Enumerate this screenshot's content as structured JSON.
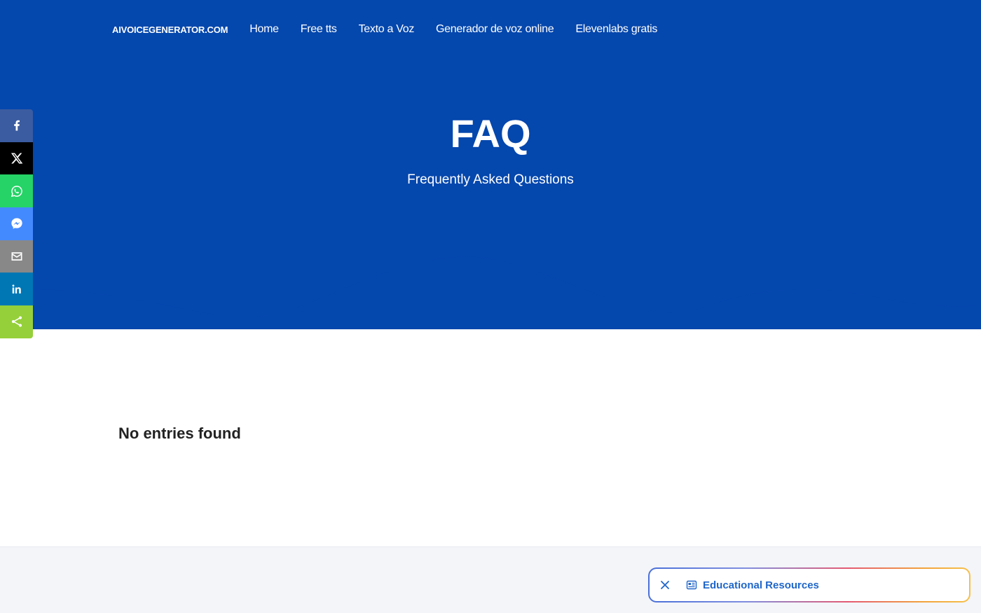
{
  "nav": {
    "brand": "AIVOICEGENERATOR.COM",
    "links": [
      "Home",
      "Free tts",
      "Texto a Voz",
      "Generador de voz online",
      "Elevenlabs gratis"
    ]
  },
  "hero": {
    "title": "FAQ",
    "subtitle": "Frequently Asked Questions",
    "background_color": "#0447ad"
  },
  "share": {
    "buttons": [
      {
        "icon": "facebook-icon",
        "color": "#3b5ca0"
      },
      {
        "icon": "x-icon",
        "color": "#000000"
      },
      {
        "icon": "whatsapp-icon",
        "color": "#25d366"
      },
      {
        "icon": "messenger-icon",
        "color": "#448aff"
      },
      {
        "icon": "email-icon",
        "color": "#888888"
      },
      {
        "icon": "linkedin-icon",
        "color": "#0077b5"
      },
      {
        "icon": "share-icon",
        "color": "#95d03a"
      }
    ]
  },
  "content": {
    "empty_message": "No entries found"
  },
  "footer": {
    "pill_label": "Educational Resources",
    "pill_icon": "newspaper-icon",
    "close_icon": "close-icon"
  }
}
